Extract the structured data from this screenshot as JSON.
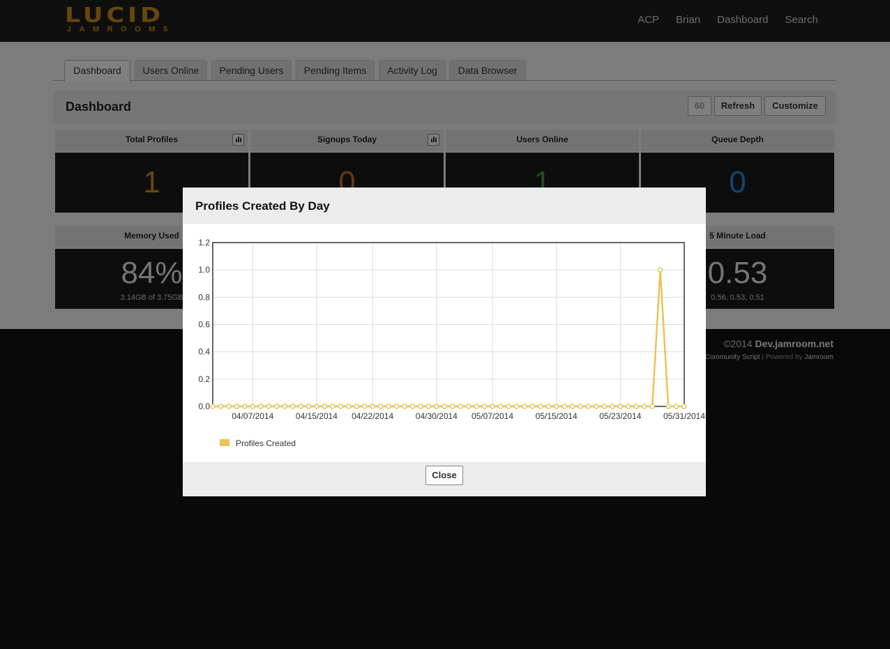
{
  "logo": {
    "main": "LUCID",
    "sub": "JAMROOM5"
  },
  "nav": [
    "ACP",
    "Brian",
    "Dashboard",
    "Search"
  ],
  "tabs": [
    "Dashboard",
    "Users Online",
    "Pending Users",
    "Pending Items",
    "Activity Log",
    "Data Browser"
  ],
  "dashboard": {
    "title": "Dashboard",
    "refresh_seconds": "60",
    "refresh_label": "Refresh",
    "customize_label": "Customize"
  },
  "tiles": [
    {
      "label": "Total Profiles",
      "value": "1",
      "color": "#c8861b",
      "has_graph": true
    },
    {
      "label": "Signups Today",
      "value": "0",
      "color": "#c86a1b",
      "has_graph": true
    },
    {
      "label": "Users Online",
      "value": "1",
      "color": "#3b9c3b",
      "has_graph": false
    },
    {
      "label": "Queue Depth",
      "value": "0",
      "color": "#1e88d8",
      "has_graph": false
    },
    {
      "label": "Memory Used",
      "value": "84%",
      "sub": "3.14GB of 3.75GB",
      "color": "#e0e0e0"
    },
    {
      "label": "5 Minute Load",
      "value": "0.53",
      "sub": "0.56, 0.53, 0.51",
      "color": "#e0e0e0"
    }
  ],
  "footer": {
    "copyright_prefix": "©2014",
    "site": "Dev.jamroom.net",
    "credit_prefix": "e Community Script",
    "credit_sep": "|",
    "powered": "Powered by",
    "powered_name": "Jamroom"
  },
  "modal": {
    "title": "Profiles Created By Day",
    "close_label": "Close"
  },
  "chart_data": {
    "type": "line",
    "title": "Profiles Created By Day",
    "series": [
      {
        "name": "Profiles Created",
        "color": "#e8c45a",
        "values": [
          0,
          0,
          0,
          0,
          0,
          0,
          0,
          0,
          0,
          0,
          0,
          0,
          0,
          0,
          0,
          0,
          0,
          0,
          0,
          0,
          0,
          0,
          0,
          0,
          0,
          0,
          0,
          0,
          0,
          0,
          0,
          0,
          0,
          0,
          0,
          0,
          0,
          0,
          0,
          0,
          0,
          0,
          0,
          0,
          0,
          0,
          0,
          0,
          0,
          0,
          0,
          0,
          0,
          0,
          0,
          0,
          1,
          0,
          0,
          0
        ]
      }
    ],
    "x_start_date": "2014-04-02",
    "x_tick_labels": [
      "04/07/2014",
      "04/15/2014",
      "04/22/2014",
      "04/30/2014",
      "05/07/2014",
      "05/15/2014",
      "05/23/2014",
      "05/31/2014"
    ],
    "y_ticks": [
      "0.0",
      "0.2",
      "0.4",
      "0.6",
      "0.8",
      "1.0",
      "1.2"
    ],
    "ylim": [
      0,
      1.2
    ],
    "grid": true,
    "legend_placement": "bottom-left"
  }
}
